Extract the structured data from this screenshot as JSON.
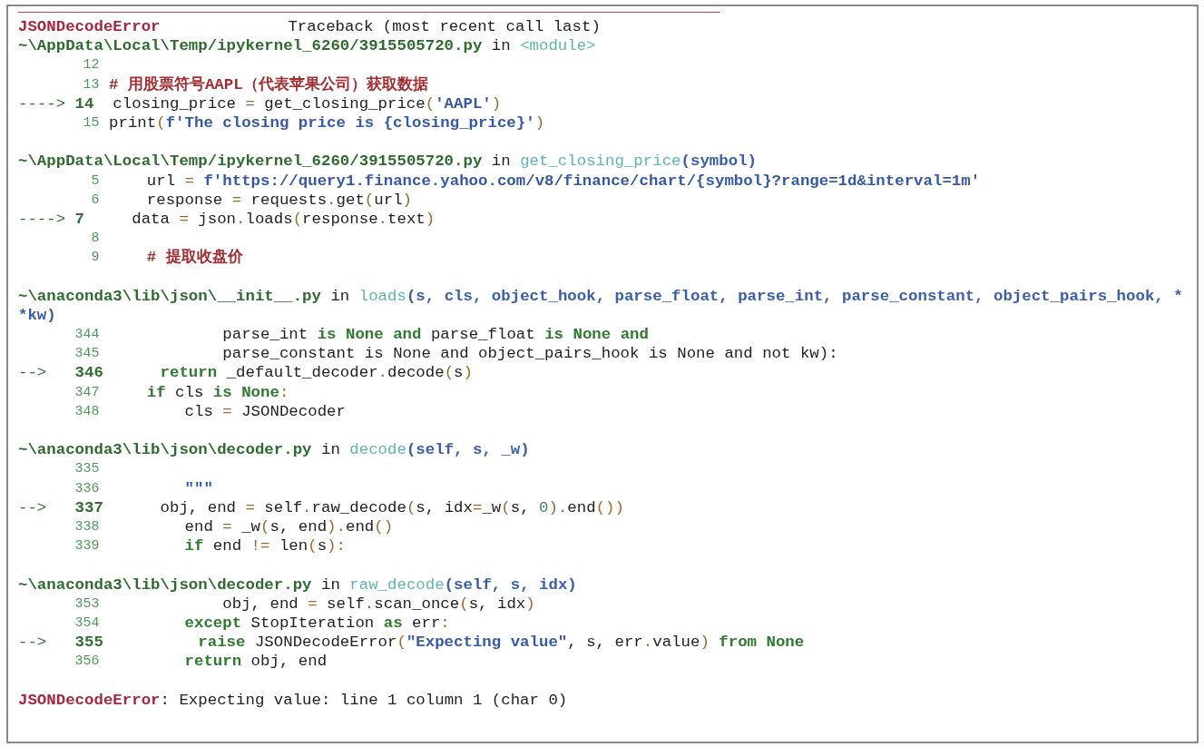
{
  "error_header": {
    "name": "JSONDecodeError",
    "title": "Traceback (most recent call last)"
  },
  "frames": [
    {
      "file": "~\\AppData\\Local\\Temp/ipykernel_6260/3915505720.py",
      "in": "in",
      "function": "<module>",
      "arrow": "---->",
      "lines": [
        {
          "number": "12",
          "current": false
        },
        {
          "number": "13",
          "current": false,
          "code": [
            {
              "kind": "comment",
              "text": "# 用股票符号AAPL（代表苹果公司）获取数据"
            }
          ]
        },
        {
          "number": "14",
          "current": true,
          "code": [
            {
              "kind": "plain",
              "text": "closing_price "
            },
            {
              "kind": "op",
              "text": "="
            },
            {
              "kind": "plain",
              "text": " get_closing_price"
            },
            {
              "kind": "op",
              "text": "("
            },
            {
              "kind": "string",
              "text": "'AAPL'"
            },
            {
              "kind": "op",
              "text": ")"
            }
          ]
        },
        {
          "number": "15",
          "current": false,
          "code": [
            {
              "kind": "plain",
              "text": "print"
            },
            {
              "kind": "op",
              "text": "("
            },
            {
              "kind": "string",
              "text": "f'The closing price is {closing_price}'"
            },
            {
              "kind": "op",
              "text": ")"
            }
          ]
        }
      ]
    },
    {
      "file": "~\\AppData\\Local\\Temp/ipykernel_6260/3915505720.py",
      "in": "in",
      "function": "get_closing_price",
      "args": "(symbol)",
      "arrow": "---->",
      "lines": [
        {
          "number": "5",
          "current": false,
          "code": [
            {
              "kind": "plain",
              "text": "    url "
            },
            {
              "kind": "op",
              "text": "="
            },
            {
              "kind": "string",
              "text": " f'https://query1.finance.yahoo.com/v8/finance/chart/{symbol}?range=1d&interval=1m'"
            }
          ]
        },
        {
          "number": "6",
          "current": false,
          "code": [
            {
              "kind": "plain",
              "text": "    response "
            },
            {
              "kind": "op",
              "text": "="
            },
            {
              "kind": "plain",
              "text": " requests"
            },
            {
              "kind": "op",
              "text": "."
            },
            {
              "kind": "plain",
              "text": "get"
            },
            {
              "kind": "op",
              "text": "("
            },
            {
              "kind": "plain",
              "text": "url"
            },
            {
              "kind": "op",
              "text": ")"
            }
          ]
        },
        {
          "number": "7",
          "current": true,
          "code": [
            {
              "kind": "plain",
              "text": "  data "
            },
            {
              "kind": "op",
              "text": "="
            },
            {
              "kind": "plain",
              "text": " json"
            },
            {
              "kind": "op",
              "text": "."
            },
            {
              "kind": "plain",
              "text": "loads"
            },
            {
              "kind": "op",
              "text": "("
            },
            {
              "kind": "plain",
              "text": "response"
            },
            {
              "kind": "op",
              "text": "."
            },
            {
              "kind": "plain",
              "text": "text"
            },
            {
              "kind": "op",
              "text": ")"
            }
          ]
        },
        {
          "number": "8",
          "current": false
        },
        {
          "number": "9",
          "current": false,
          "code": [
            {
              "kind": "comment",
              "text": "    # 提取收盘价"
            }
          ]
        }
      ]
    },
    {
      "file": "~\\anaconda3\\lib\\json\\__init__.py",
      "in": "in",
      "function": "loads",
      "args": "(s, cls, object_hook, parse_float, parse_int, parse_constant, object_pairs_hook, **kw)",
      "arrow": "-->",
      "lines": [
        {
          "number": "344",
          "current": false,
          "code": [
            {
              "kind": "plain",
              "text": "            parse_int "
            },
            {
              "kind": "keyword",
              "text": "is None and"
            },
            {
              "kind": "plain",
              "text": " parse_float "
            },
            {
              "kind": "keyword",
              "text": "is None and"
            }
          ]
        },
        {
          "number": "345",
          "current": false,
          "code": [
            {
              "kind": "plain",
              "text": "            parse_constant is None and object_pairs_hook is None and not kw):"
            }
          ]
        },
        {
          "number": "346",
          "current": true,
          "code": [
            {
              "kind": "keyword",
              "text": "     return"
            },
            {
              "kind": "plain",
              "text": " _default_decoder"
            },
            {
              "kind": "op",
              "text": "."
            },
            {
              "kind": "plain",
              "text": "decode"
            },
            {
              "kind": "op",
              "text": "("
            },
            {
              "kind": "plain",
              "text": "s"
            },
            {
              "kind": "op",
              "text": ")"
            }
          ]
        },
        {
          "number": "347",
          "current": false,
          "code": [
            {
              "kind": "keyword",
              "text": "    if"
            },
            {
              "kind": "plain",
              "text": " cls "
            },
            {
              "kind": "keyword",
              "text": "is None"
            },
            {
              "kind": "op",
              "text": ":"
            }
          ]
        },
        {
          "number": "348",
          "current": false,
          "code": [
            {
              "kind": "plain",
              "text": "        cls "
            },
            {
              "kind": "op",
              "text": "="
            },
            {
              "kind": "plain",
              "text": " JSONDecoder"
            }
          ]
        }
      ]
    },
    {
      "file": "~\\anaconda3\\lib\\json\\decoder.py",
      "in": "in",
      "function": "decode",
      "args": "(self, s, _w)",
      "arrow": "-->",
      "lines": [
        {
          "number": "335",
          "current": false
        },
        {
          "number": "336",
          "current": false,
          "code": [
            {
              "kind": "string",
              "text": "        \"\"\""
            }
          ]
        },
        {
          "number": "337",
          "current": true,
          "code": [
            {
              "kind": "plain",
              "text": "     obj, end "
            },
            {
              "kind": "op",
              "text": "="
            },
            {
              "kind": "plain",
              "text": " self"
            },
            {
              "kind": "op",
              "text": "."
            },
            {
              "kind": "plain",
              "text": "raw_decode"
            },
            {
              "kind": "op",
              "text": "("
            },
            {
              "kind": "plain",
              "text": "s, idx"
            },
            {
              "kind": "op",
              "text": "="
            },
            {
              "kind": "plain",
              "text": "_w"
            },
            {
              "kind": "op",
              "text": "("
            },
            {
              "kind": "plain",
              "text": "s, "
            },
            {
              "kind": "number",
              "text": "0"
            },
            {
              "kind": "op",
              "text": ")."
            },
            {
              "kind": "plain",
              "text": "end"
            },
            {
              "kind": "op",
              "text": "())"
            }
          ]
        },
        {
          "number": "338",
          "current": false,
          "code": [
            {
              "kind": "plain",
              "text": "        end "
            },
            {
              "kind": "op",
              "text": "="
            },
            {
              "kind": "plain",
              "text": " _w"
            },
            {
              "kind": "op",
              "text": "("
            },
            {
              "kind": "plain",
              "text": "s, end"
            },
            {
              "kind": "op",
              "text": ")."
            },
            {
              "kind": "plain",
              "text": "end"
            },
            {
              "kind": "op",
              "text": "()"
            }
          ]
        },
        {
          "number": "339",
          "current": false,
          "code": [
            {
              "kind": "keyword",
              "text": "        if"
            },
            {
              "kind": "plain",
              "text": " end "
            },
            {
              "kind": "op",
              "text": "!="
            },
            {
              "kind": "plain",
              "text": " len"
            },
            {
              "kind": "op",
              "text": "("
            },
            {
              "kind": "plain",
              "text": "s"
            },
            {
              "kind": "op",
              "text": "):"
            }
          ]
        }
      ]
    },
    {
      "file": "~\\anaconda3\\lib\\json\\decoder.py",
      "in": "in",
      "function": "raw_decode",
      "args": "(self, s, idx)",
      "arrow": "-->",
      "lines": [
        {
          "number": "353",
          "current": false,
          "code": [
            {
              "kind": "plain",
              "text": "            obj, end "
            },
            {
              "kind": "op",
              "text": "="
            },
            {
              "kind": "plain",
              "text": " self"
            },
            {
              "kind": "op",
              "text": "."
            },
            {
              "kind": "plain",
              "text": "scan_once"
            },
            {
              "kind": "op",
              "text": "("
            },
            {
              "kind": "plain",
              "text": "s, idx"
            },
            {
              "kind": "op",
              "text": ")"
            }
          ]
        },
        {
          "number": "354",
          "current": false,
          "code": [
            {
              "kind": "keyword",
              "text": "        except"
            },
            {
              "kind": "plain",
              "text": " StopIteration "
            },
            {
              "kind": "keyword",
              "text": "as"
            },
            {
              "kind": "plain",
              "text": " err"
            },
            {
              "kind": "op",
              "text": ":"
            }
          ]
        },
        {
          "number": "355",
          "current": true,
          "code": [
            {
              "kind": "keyword",
              "text": "         raise"
            },
            {
              "kind": "plain",
              "text": " JSONDecodeError"
            },
            {
              "kind": "op",
              "text": "("
            },
            {
              "kind": "string",
              "text": "\"Expecting value\""
            },
            {
              "kind": "plain",
              "text": ", s, err"
            },
            {
              "kind": "op",
              "text": "."
            },
            {
              "kind": "plain",
              "text": "value"
            },
            {
              "kind": "op",
              "text": ")"
            },
            {
              "kind": "keyword",
              "text": " from None"
            }
          ]
        },
        {
          "number": "356",
          "current": false,
          "code": [
            {
              "kind": "keyword",
              "text": "        return"
            },
            {
              "kind": "plain",
              "text": " obj, end"
            }
          ]
        }
      ]
    }
  ],
  "error_message": {
    "name": "JSONDecodeError",
    "text": ": Expecting value: line 1 column 1 (char 0)"
  }
}
